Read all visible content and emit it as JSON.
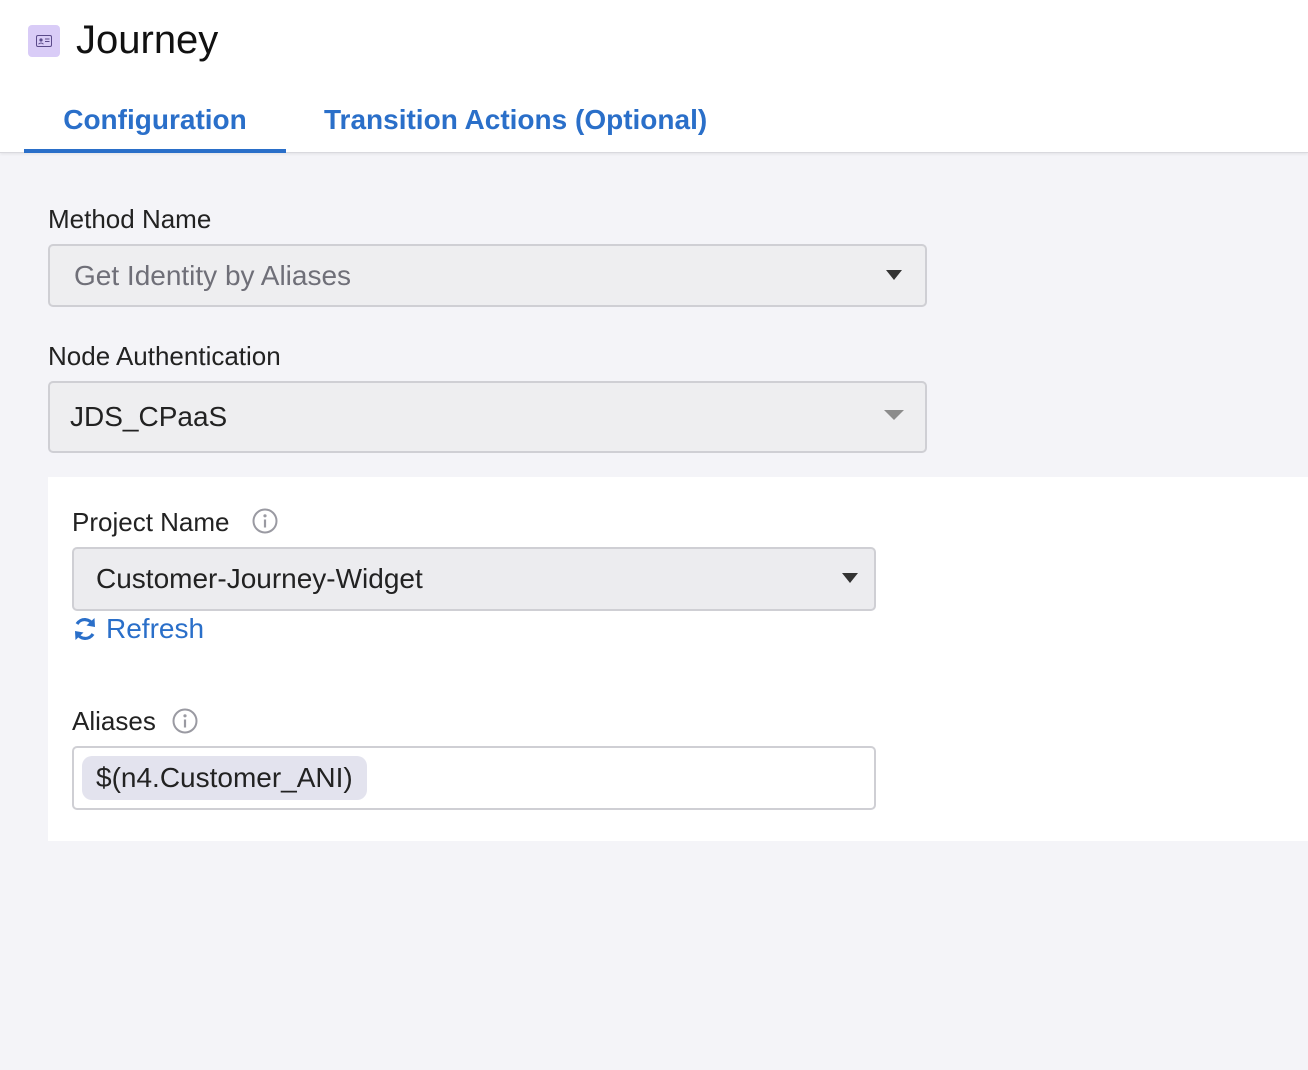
{
  "header": {
    "title": "Journey",
    "icon": "contact-card-icon"
  },
  "tabs": [
    {
      "label": "Configuration",
      "active": true
    },
    {
      "label": "Transition Actions (Optional)",
      "active": false
    }
  ],
  "form": {
    "method_name": {
      "label": "Method Name",
      "value": "Get Identity by Aliases"
    },
    "node_authentication": {
      "label": "Node Authentication",
      "value": "JDS_CPaaS"
    },
    "project_name": {
      "label": "Project Name",
      "value": "Customer-Journey-Widget"
    },
    "refresh_label": "Refresh",
    "aliases": {
      "label": "Aliases",
      "chip": "$(n4.Customer_ANI)"
    }
  },
  "colors": {
    "accent": "#2a6fc9",
    "icon_bg": "#d9ccf7",
    "page_bg": "#f4f4f8"
  }
}
